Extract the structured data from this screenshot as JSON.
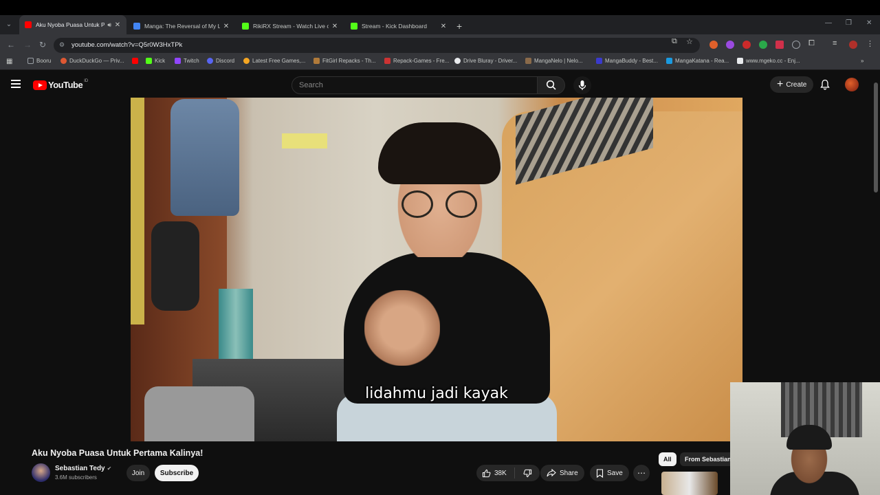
{
  "browser": {
    "tabs": [
      {
        "title": "Aku Nyoba Puasa Untuk Pe",
        "favicon_color": "#ff0000",
        "active": true,
        "audio": true
      },
      {
        "title": "Manga: The Reversal of My Life",
        "favicon_color": "#4285f4",
        "active": false,
        "audio": false
      },
      {
        "title": "RikiRX Stream - Watch Live on",
        "favicon_color": "#53fc18",
        "active": false,
        "audio": false
      },
      {
        "title": "Stream - Kick Dashboard",
        "favicon_color": "#53fc18",
        "active": false,
        "audio": false
      }
    ],
    "url": "youtube.com/watch?v=Q5r0W3HxTPk",
    "bookmarks": [
      {
        "label": "Booru",
        "color": "#9aa0a6"
      },
      {
        "label": "DuckDuckGo — Priv...",
        "color": "#de5833"
      },
      {
        "label": "",
        "color": "#ff0000"
      },
      {
        "label": "Kick",
        "color": "#53fc18"
      },
      {
        "label": "Twitch",
        "color": "#9146ff"
      },
      {
        "label": "Discord",
        "color": "#5865f2"
      },
      {
        "label": "Latest Free Games,...",
        "color": "#f5a623"
      },
      {
        "label": "FitGirl Repacks - Th...",
        "color": "#b07a3a"
      },
      {
        "label": "Repack-Games - Fre...",
        "color": "#cc3333"
      },
      {
        "label": "Drive Bluray - Driver...",
        "color": "#e8eaed"
      },
      {
        "label": "MangaNelo | Nelo...",
        "color": "#8a6a4a"
      },
      {
        "label": "MangaBuddy - Best...",
        "color": "#3a3acc"
      },
      {
        "label": "MangaKatana - Rea...",
        "color": "#1a9ae0"
      },
      {
        "label": "www.mgeko.cc - Enj...",
        "color": "#e8eaed"
      }
    ]
  },
  "youtube": {
    "logo_text": "YouTube",
    "logo_country": "ID",
    "search_placeholder": "Search",
    "create_label": "Create"
  },
  "video": {
    "caption": "lidahmu jadi kayak",
    "title": "Aku Nyoba Puasa Untuk Pertama Kalinya!",
    "channel_name": "Sebastian Tedy",
    "subscribers": "3.6M subscribers",
    "join_label": "Join",
    "subscribe_label": "Subscribe",
    "likes": "38K",
    "share_label": "Share",
    "save_label": "Save"
  },
  "sidebar": {
    "chips": [
      {
        "label": "All",
        "active": true
      },
      {
        "label": "From Sebastian",
        "active": false
      }
    ]
  }
}
